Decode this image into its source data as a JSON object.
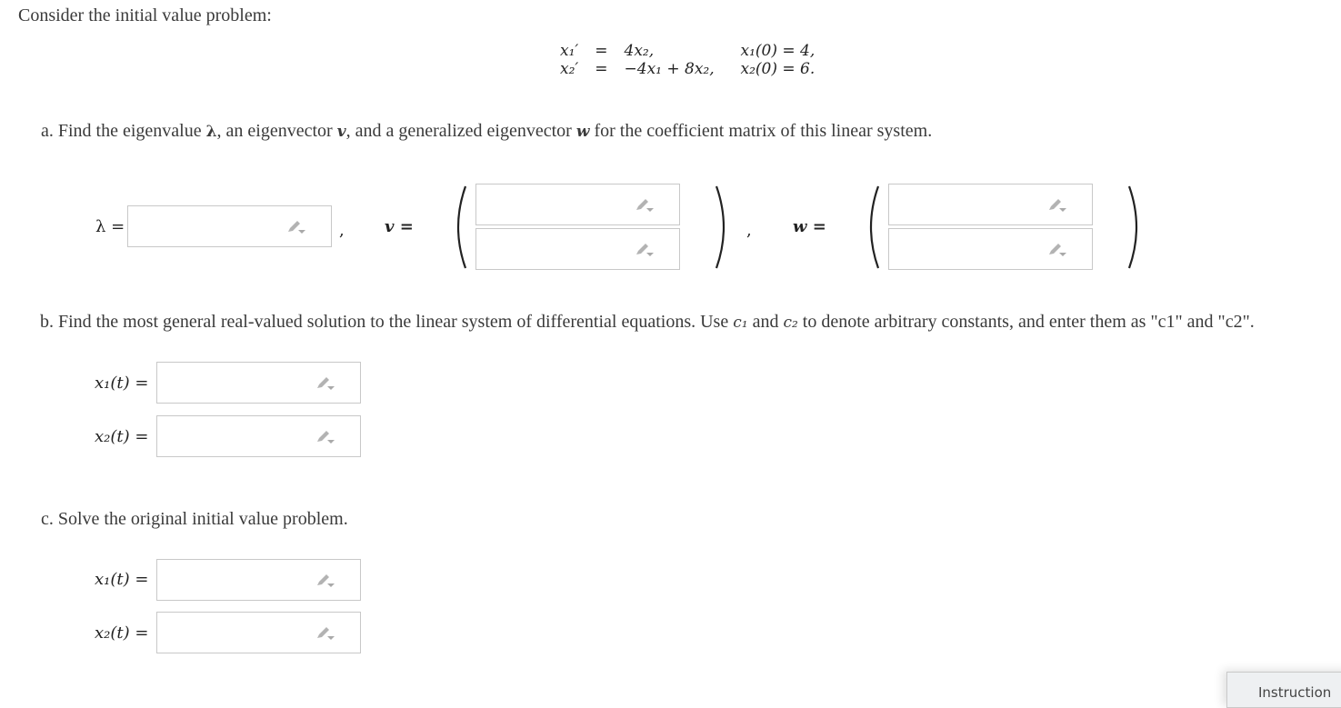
{
  "intro": "Consider the initial value problem:",
  "system": {
    "rows": [
      {
        "lhs": "x₁′",
        "eq": "=",
        "rhs": "4x₂,",
        "ic": "x₁(0) = 4,"
      },
      {
        "lhs": "x₂′",
        "eq": "=",
        "rhs": "−4x₁ + 8x₂,",
        "ic": "x₂(0) = 6."
      }
    ]
  },
  "part_a": {
    "prompt_1": "a. Find the eigenvalue ",
    "lambda": "λ",
    "prompt_2": ", an eigenvector ",
    "v": "v",
    "prompt_3": ", and a generalized eigenvector ",
    "w": "w",
    "prompt_4": " for the coefficient matrix of this linear system.",
    "lambda_label": "λ =",
    "v_label": "v =",
    "w_label": "w =",
    "comma": ",",
    "lambda_value": "",
    "v_values": [
      "",
      ""
    ],
    "w_values": [
      "",
      ""
    ]
  },
  "part_b": {
    "prompt_1": "b. Find the most general real-valued solution to the linear system of differential equations. Use ",
    "c1": "c₁",
    "and": " and ",
    "c2": "c₂",
    "prompt_2": " to denote arbitrary constants, and enter them as \"c1\" and \"c2\".",
    "x1_label": "x₁(t) =",
    "x2_label": "x₂(t) =",
    "x1_value": "",
    "x2_value": ""
  },
  "part_c": {
    "prompt": "c. Solve the original initial value problem.",
    "x1_label": "x₁(t) =",
    "x2_label": "x₂(t) =",
    "x1_value": "",
    "x2_value": ""
  },
  "instructions_tab": "Instruction",
  "icons": {
    "edit": "pencil-dropdown-icon"
  }
}
